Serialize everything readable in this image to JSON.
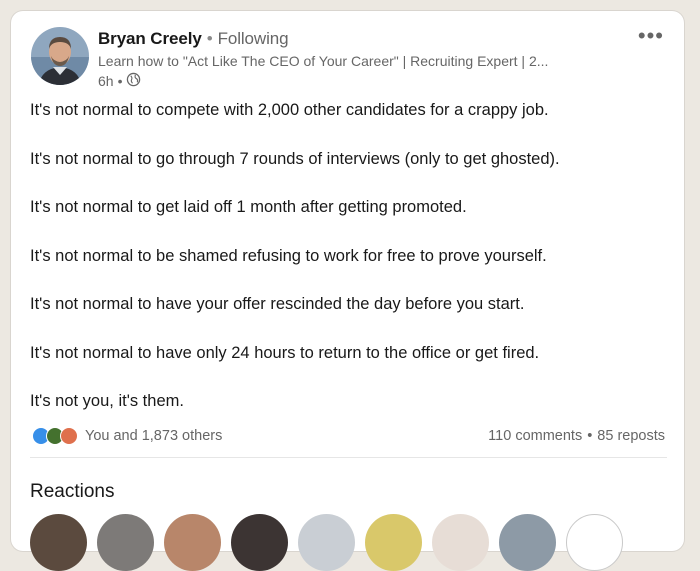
{
  "author": {
    "name": "Bryan Creely",
    "follow_status": "Following",
    "headline": "Learn how to \"Act Like The CEO of Your Career\" | Recruiting Expert | 2...",
    "time": "6h",
    "visibility_icon": "globe-icon"
  },
  "post": {
    "lines": [
      "It's not normal to compete with 2,000 other candidates for a crappy job.",
      "It's not normal to go through 7 rounds of interviews (only to get ghosted).",
      "It's not normal to get laid off 1 month after getting promoted.",
      "It's not normal to be shamed refusing to work for free to prove yourself.",
      "It's not normal to have your offer rescinded the day before you start.",
      "It's not normal to have only 24 hours to return to the office or get fired.",
      "It's not you, it's them."
    ]
  },
  "social": {
    "reaction_icons": [
      "like-icon",
      "celebrate-icon",
      "love-icon"
    ],
    "reactions_text": "You and 1,873 others",
    "comments": "110 comments",
    "reposts": "85 reposts"
  },
  "reactions_section": {
    "title": "Reactions"
  },
  "colors": {
    "like": "#378fe9",
    "celebrate": "#44712e",
    "love": "#df704d",
    "text_primary": "#191919",
    "text_secondary": "#666666",
    "background": "#ece8e1"
  }
}
